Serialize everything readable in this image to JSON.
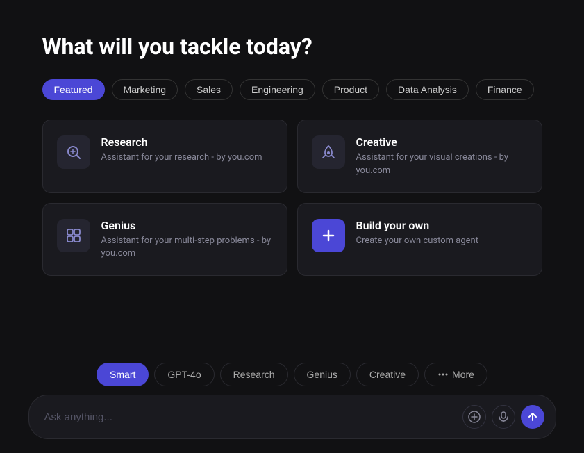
{
  "page": {
    "title": "What will you tackle today?"
  },
  "filterTabs": [
    {
      "id": "featured",
      "label": "Featured",
      "active": true
    },
    {
      "id": "marketing",
      "label": "Marketing",
      "active": false
    },
    {
      "id": "sales",
      "label": "Sales",
      "active": false
    },
    {
      "id": "engineering",
      "label": "Engineering",
      "active": false
    },
    {
      "id": "product",
      "label": "Product",
      "active": false
    },
    {
      "id": "data-analysis",
      "label": "Data Analysis",
      "active": false
    },
    {
      "id": "finance",
      "label": "Finance",
      "active": false
    }
  ],
  "cards": [
    {
      "id": "research",
      "title": "Research",
      "description": "Assistant for your research - by you.com",
      "icon": "research"
    },
    {
      "id": "creative",
      "title": "Creative",
      "description": "Assistant for your visual creations - by you.com",
      "icon": "creative"
    },
    {
      "id": "genius",
      "title": "Genius",
      "description": "Assistant for your multi-step problems - by you.com",
      "icon": "genius"
    },
    {
      "id": "build-your-own",
      "title": "Build your own",
      "description": "Create your own custom agent",
      "icon": "plus"
    }
  ],
  "modeTabs": [
    {
      "id": "smart",
      "label": "Smart",
      "active": true
    },
    {
      "id": "gpt4o",
      "label": "GPT-4o",
      "active": false
    },
    {
      "id": "research",
      "label": "Research",
      "active": false
    },
    {
      "id": "genius",
      "label": "Genius",
      "active": false
    },
    {
      "id": "creative",
      "label": "Creative",
      "active": false
    },
    {
      "id": "more",
      "label": "More",
      "active": false,
      "hasIcon": true
    }
  ],
  "input": {
    "placeholder": "Ask anything..."
  },
  "buttons": {
    "add": "+",
    "mic": "🎤",
    "send": "↑"
  }
}
